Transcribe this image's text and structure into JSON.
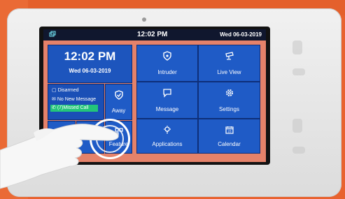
{
  "statusbar": {
    "time": "12:02 PM",
    "day_date": "Wed  06-03-2019"
  },
  "clock": {
    "time": "12:02 PM",
    "date": "Wed 06-03-2019"
  },
  "status": {
    "disarmed": "Disarmed",
    "message": "No New Message",
    "missed_call": "(7)Missed Call"
  },
  "away": {
    "label": "Away"
  },
  "tiles": [
    {
      "label": "Intruder",
      "icon": "shield-icon"
    },
    {
      "label": "Live View",
      "icon": "camera-icon"
    },
    {
      "label": "Message",
      "icon": "message-icon"
    },
    {
      "label": "Settings",
      "icon": "gear-icon"
    },
    {
      "label": "Applications",
      "icon": "lightbulb-icon"
    },
    {
      "label": "Calendar",
      "icon": "calendar-icon"
    }
  ],
  "bottom": {
    "feature_label": "Feature"
  },
  "colors": {
    "tile_blue": "#1f5bc6",
    "screen_bg": "#e5826a",
    "missed_call_green": "#23c57a",
    "wall_orange": "#e8622f"
  }
}
